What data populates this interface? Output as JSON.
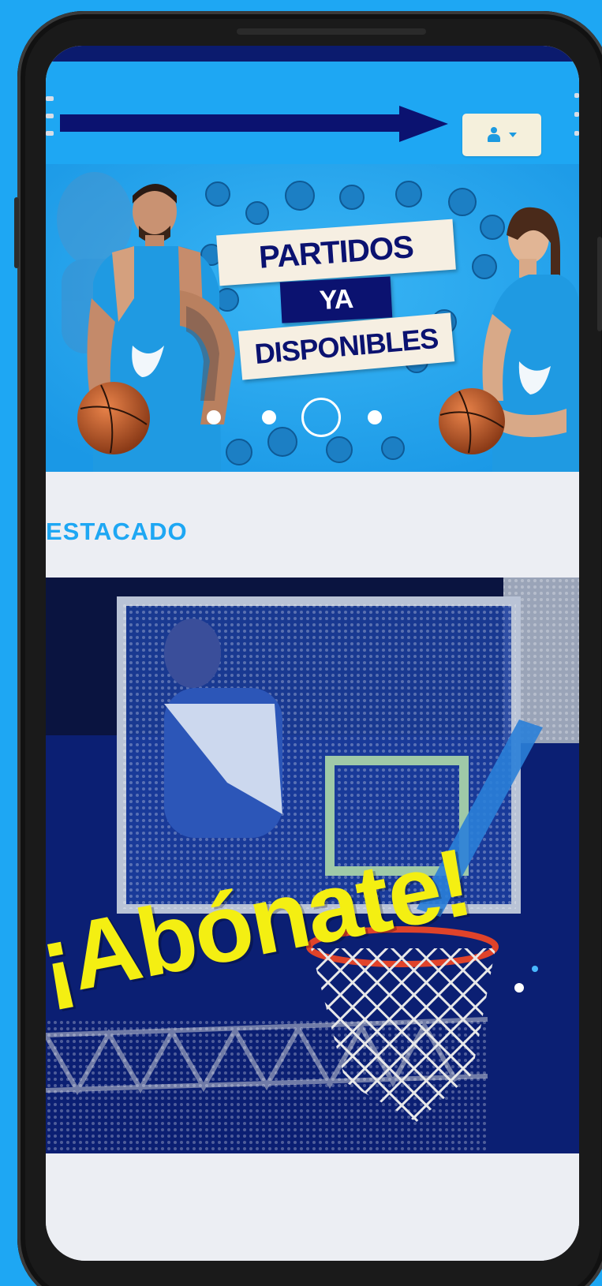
{
  "header": {
    "user_menu_icon": "user-icon",
    "user_menu_caret": "caret-down-icon"
  },
  "banner": {
    "line1": "PARTIDOS",
    "line2": "YA",
    "line3": "DISPONIBLES",
    "slides_total": 4,
    "active_slide": 3
  },
  "section": {
    "title": "ESTACADO"
  },
  "promo": {
    "text": "¡Abónate!"
  },
  "colors": {
    "accent": "#1ea7f3",
    "navy": "#0b1270",
    "promo_yellow": "#f4ef12"
  }
}
